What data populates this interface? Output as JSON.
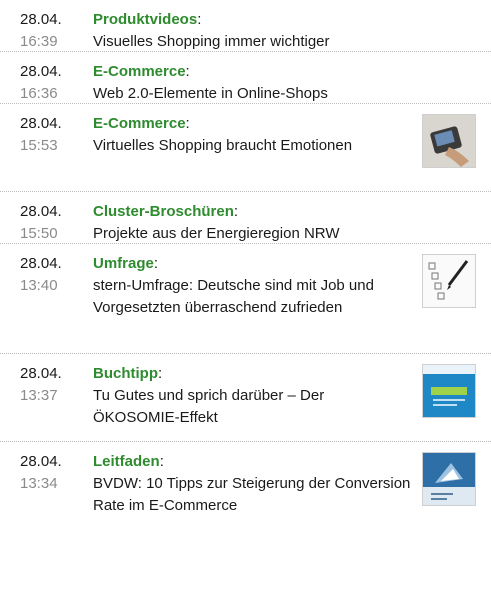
{
  "items": [
    {
      "date": "28.04.",
      "time": "16:39",
      "category": "Produktvideos",
      "title": "Visuelles Shopping immer wichtiger"
    },
    {
      "date": "28.04.",
      "time": "16:36",
      "category": "E-Commerce",
      "title": "Web 2.0-Elemente in Online-Shops"
    },
    {
      "date": "28.04.",
      "time": "15:53",
      "category": "E-Commerce",
      "title": "Virtuelles Shopping braucht Emotionen",
      "thumb": "mobile-phone-photo"
    },
    {
      "date": "28.04.",
      "time": "15:50",
      "category": "Cluster-Broschüren",
      "title": "Projekte aus der Energieregion NRW"
    },
    {
      "date": "28.04.",
      "time": "13:40",
      "category": "Umfrage",
      "title": "stern-Umfrage: Deutsche sind mit Job und Vorgesetzten überraschend zufrieden",
      "thumb": "checklist-pen-image"
    },
    {
      "date": "28.04.",
      "time": "13:37",
      "category": "Buchtipp",
      "title": "Tu Gutes und sprich darüber – Der ÖKOSOMIE-Effekt",
      "thumb": "book-cover-image"
    },
    {
      "date": "28.04.",
      "time": "13:34",
      "category": "Leitfaden",
      "title": "BVDW: 10 Tipps zur Steigerung der Conversion Rate im E-Commerce",
      "thumb": "guide-cover-image"
    }
  ],
  "colors": {
    "category": "#2e8b2e",
    "time": "#8a8a8a",
    "text": "#1a1a1a",
    "divider": "#bdbdbd"
  }
}
